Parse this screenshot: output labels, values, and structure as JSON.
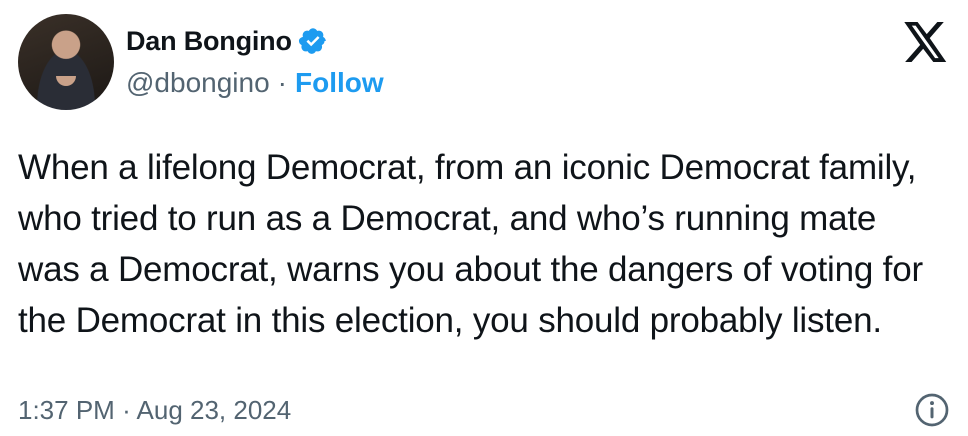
{
  "author": {
    "display_name": "Dan Bongino",
    "handle": "@dbongino",
    "separator": "·",
    "follow_label": "Follow"
  },
  "tweet": {
    "text": "When a lifelong Democrat, from an iconic Democrat family, who tried to run as a Democrat, and who’s running mate was a Democrat, warns you about the dangers of voting for the Democrat in this election, you should probably listen."
  },
  "footer": {
    "time": "1:37 PM",
    "separator": "·",
    "date": "Aug 23, 2024"
  },
  "icons": {
    "verified": "verified-badge-icon",
    "logo": "x-logo-icon",
    "info": "info-icon"
  },
  "colors": {
    "accent": "#1d9bf0",
    "text": "#0f1419",
    "muted": "#536471"
  }
}
